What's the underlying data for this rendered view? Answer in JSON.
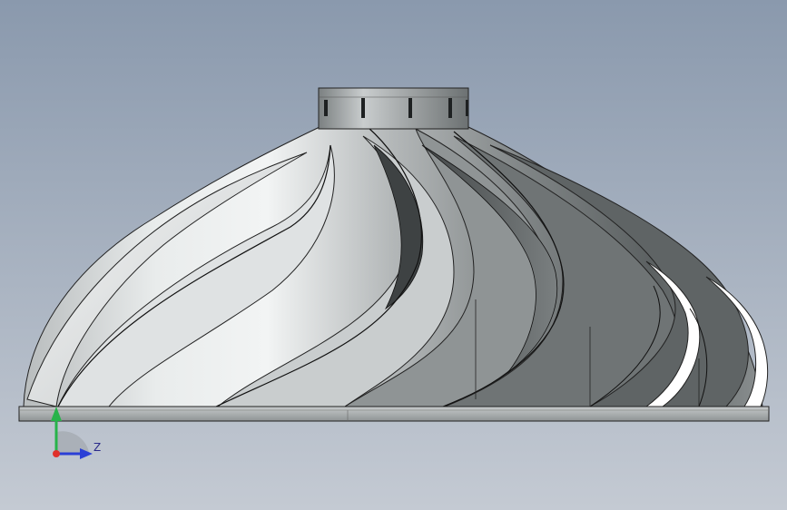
{
  "viewport": {
    "background_top": "#8a99ad",
    "background_bottom": "#c4cad3"
  },
  "model": {
    "part": "impeller",
    "metal_light": "#e6e9ea",
    "metal_mid": "#a9aeaf",
    "metal_dark": "#4d5253",
    "edge_color": "#1a1a1a"
  },
  "triad": {
    "horizontal_axis_label": "Z",
    "x_axis_color": "#e0302a",
    "y_axis_color": "#27b34a",
    "z_axis_color": "#2b3fd6",
    "icons": [
      "y-axis-arrow-icon",
      "z-axis-arrow-icon",
      "x-axis-dot-icon"
    ]
  }
}
